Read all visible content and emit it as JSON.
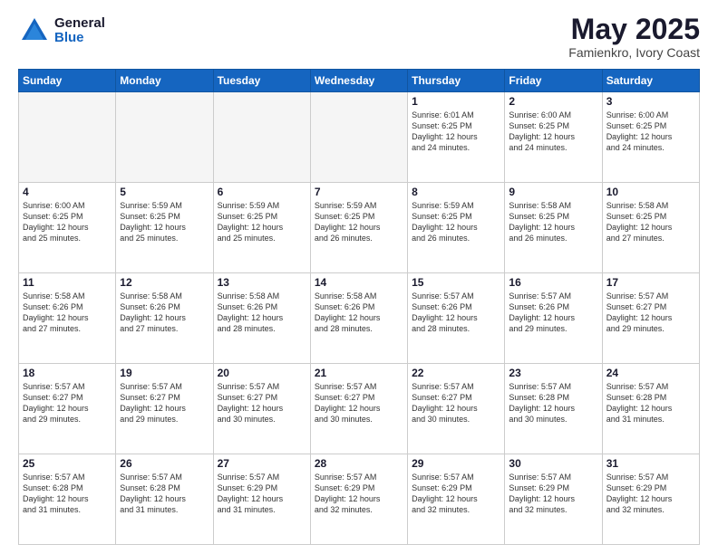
{
  "header": {
    "logo_general": "General",
    "logo_blue": "Blue",
    "month_title": "May 2025",
    "location": "Famienkro, Ivory Coast"
  },
  "days_of_week": [
    "Sunday",
    "Monday",
    "Tuesday",
    "Wednesday",
    "Thursday",
    "Friday",
    "Saturday"
  ],
  "weeks": [
    [
      {
        "day": "",
        "info": ""
      },
      {
        "day": "",
        "info": ""
      },
      {
        "day": "",
        "info": ""
      },
      {
        "day": "",
        "info": ""
      },
      {
        "day": "1",
        "info": "Sunrise: 6:01 AM\nSunset: 6:25 PM\nDaylight: 12 hours\nand 24 minutes."
      },
      {
        "day": "2",
        "info": "Sunrise: 6:00 AM\nSunset: 6:25 PM\nDaylight: 12 hours\nand 24 minutes."
      },
      {
        "day": "3",
        "info": "Sunrise: 6:00 AM\nSunset: 6:25 PM\nDaylight: 12 hours\nand 24 minutes."
      }
    ],
    [
      {
        "day": "4",
        "info": "Sunrise: 6:00 AM\nSunset: 6:25 PM\nDaylight: 12 hours\nand 25 minutes."
      },
      {
        "day": "5",
        "info": "Sunrise: 5:59 AM\nSunset: 6:25 PM\nDaylight: 12 hours\nand 25 minutes."
      },
      {
        "day": "6",
        "info": "Sunrise: 5:59 AM\nSunset: 6:25 PM\nDaylight: 12 hours\nand 25 minutes."
      },
      {
        "day": "7",
        "info": "Sunrise: 5:59 AM\nSunset: 6:25 PM\nDaylight: 12 hours\nand 26 minutes."
      },
      {
        "day": "8",
        "info": "Sunrise: 5:59 AM\nSunset: 6:25 PM\nDaylight: 12 hours\nand 26 minutes."
      },
      {
        "day": "9",
        "info": "Sunrise: 5:58 AM\nSunset: 6:25 PM\nDaylight: 12 hours\nand 26 minutes."
      },
      {
        "day": "10",
        "info": "Sunrise: 5:58 AM\nSunset: 6:25 PM\nDaylight: 12 hours\nand 27 minutes."
      }
    ],
    [
      {
        "day": "11",
        "info": "Sunrise: 5:58 AM\nSunset: 6:26 PM\nDaylight: 12 hours\nand 27 minutes."
      },
      {
        "day": "12",
        "info": "Sunrise: 5:58 AM\nSunset: 6:26 PM\nDaylight: 12 hours\nand 27 minutes."
      },
      {
        "day": "13",
        "info": "Sunrise: 5:58 AM\nSunset: 6:26 PM\nDaylight: 12 hours\nand 28 minutes."
      },
      {
        "day": "14",
        "info": "Sunrise: 5:58 AM\nSunset: 6:26 PM\nDaylight: 12 hours\nand 28 minutes."
      },
      {
        "day": "15",
        "info": "Sunrise: 5:57 AM\nSunset: 6:26 PM\nDaylight: 12 hours\nand 28 minutes."
      },
      {
        "day": "16",
        "info": "Sunrise: 5:57 AM\nSunset: 6:26 PM\nDaylight: 12 hours\nand 29 minutes."
      },
      {
        "day": "17",
        "info": "Sunrise: 5:57 AM\nSunset: 6:27 PM\nDaylight: 12 hours\nand 29 minutes."
      }
    ],
    [
      {
        "day": "18",
        "info": "Sunrise: 5:57 AM\nSunset: 6:27 PM\nDaylight: 12 hours\nand 29 minutes."
      },
      {
        "day": "19",
        "info": "Sunrise: 5:57 AM\nSunset: 6:27 PM\nDaylight: 12 hours\nand 29 minutes."
      },
      {
        "day": "20",
        "info": "Sunrise: 5:57 AM\nSunset: 6:27 PM\nDaylight: 12 hours\nand 30 minutes."
      },
      {
        "day": "21",
        "info": "Sunrise: 5:57 AM\nSunset: 6:27 PM\nDaylight: 12 hours\nand 30 minutes."
      },
      {
        "day": "22",
        "info": "Sunrise: 5:57 AM\nSunset: 6:27 PM\nDaylight: 12 hours\nand 30 minutes."
      },
      {
        "day": "23",
        "info": "Sunrise: 5:57 AM\nSunset: 6:28 PM\nDaylight: 12 hours\nand 30 minutes."
      },
      {
        "day": "24",
        "info": "Sunrise: 5:57 AM\nSunset: 6:28 PM\nDaylight: 12 hours\nand 31 minutes."
      }
    ],
    [
      {
        "day": "25",
        "info": "Sunrise: 5:57 AM\nSunset: 6:28 PM\nDaylight: 12 hours\nand 31 minutes."
      },
      {
        "day": "26",
        "info": "Sunrise: 5:57 AM\nSunset: 6:28 PM\nDaylight: 12 hours\nand 31 minutes."
      },
      {
        "day": "27",
        "info": "Sunrise: 5:57 AM\nSunset: 6:29 PM\nDaylight: 12 hours\nand 31 minutes."
      },
      {
        "day": "28",
        "info": "Sunrise: 5:57 AM\nSunset: 6:29 PM\nDaylight: 12 hours\nand 32 minutes."
      },
      {
        "day": "29",
        "info": "Sunrise: 5:57 AM\nSunset: 6:29 PM\nDaylight: 12 hours\nand 32 minutes."
      },
      {
        "day": "30",
        "info": "Sunrise: 5:57 AM\nSunset: 6:29 PM\nDaylight: 12 hours\nand 32 minutes."
      },
      {
        "day": "31",
        "info": "Sunrise: 5:57 AM\nSunset: 6:29 PM\nDaylight: 12 hours\nand 32 minutes."
      }
    ]
  ]
}
